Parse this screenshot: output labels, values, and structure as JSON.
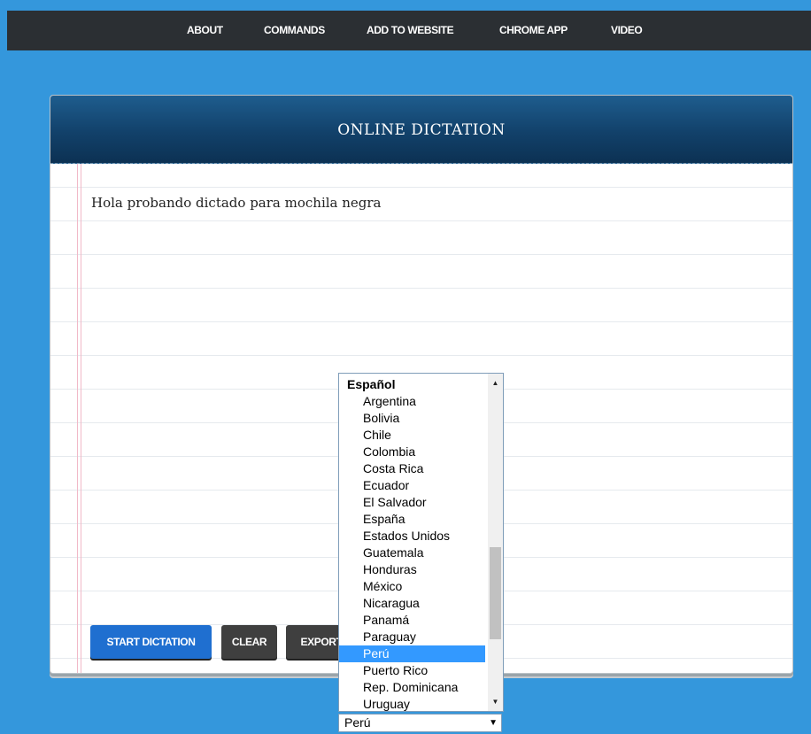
{
  "nav": {
    "items": [
      {
        "label": "ABOUT"
      },
      {
        "label": "COMMANDS"
      },
      {
        "label": "ADD TO WEBSITE"
      },
      {
        "label": "CHROME APP"
      },
      {
        "label": "VIDEO"
      }
    ]
  },
  "panel": {
    "title": "ONLINE DICTATION",
    "text": "Hola probando dictado para mochila negra"
  },
  "buttons": {
    "start": "START DICTATION",
    "clear": "CLEAR",
    "export": "EXPORT"
  },
  "language_dropdown": {
    "group": "Español",
    "options": [
      "Argentina",
      "Bolivia",
      "Chile",
      "Colombia",
      "Costa Rica",
      "Ecuador",
      "El Salvador",
      "España",
      "Estados Unidos",
      "Guatemala",
      "Honduras",
      "México",
      "Nicaragua",
      "Panamá",
      "Paraguay",
      "Perú",
      "Puerto Rico",
      "Rep. Dominicana",
      "Uruguay"
    ],
    "highlighted": "Perú",
    "selected_value": "Perú"
  },
  "icons": {
    "scroll_up": "scroll-up-arrow-icon",
    "scroll_down": "scroll-down-arrow-icon",
    "dropdown": "dropdown-arrow-icon"
  },
  "colors": {
    "page_background": "#3497dc",
    "nav_background": "#2b2f33",
    "header_background": "#12416a",
    "start_button": "#1f6fd0",
    "secondary_button": "#3f3f3f",
    "option_highlight": "#3399ff"
  }
}
